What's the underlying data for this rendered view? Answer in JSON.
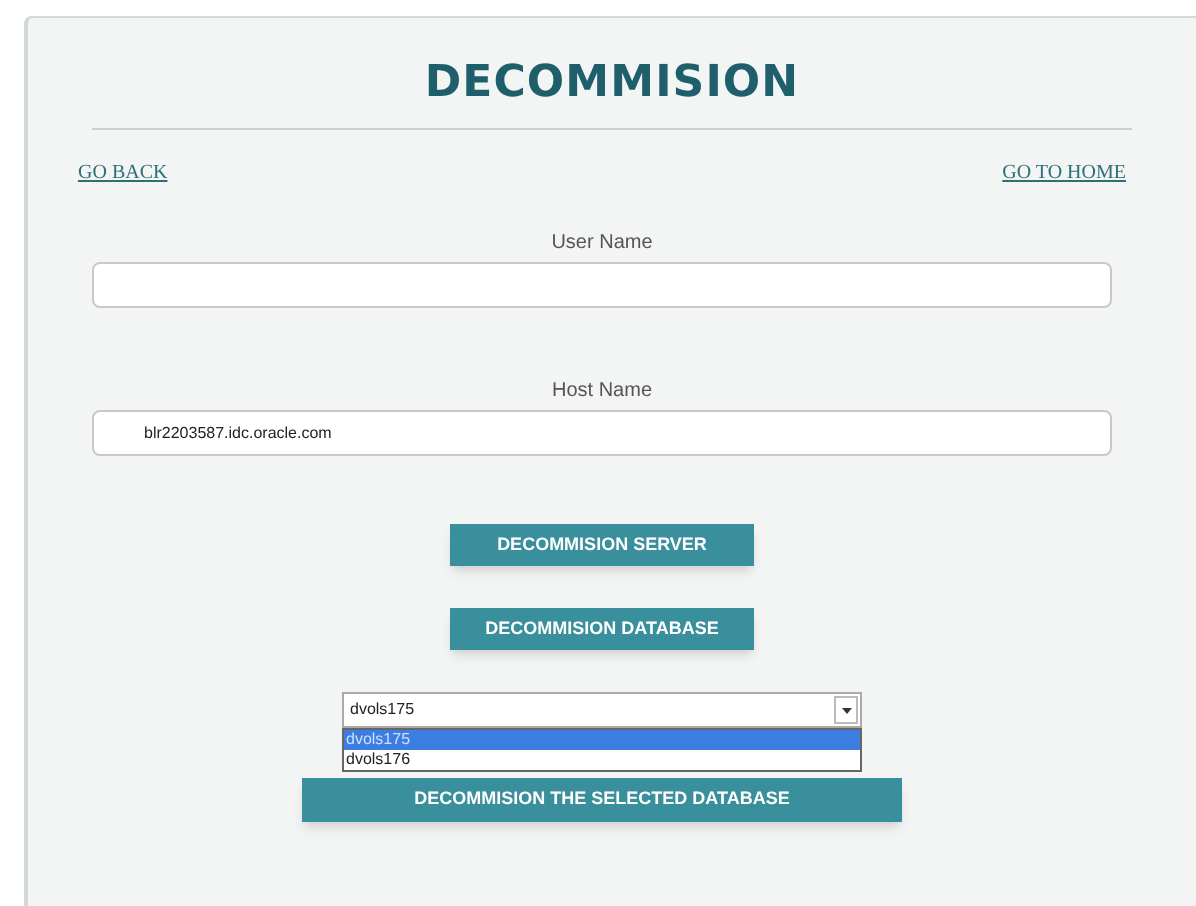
{
  "title": "DECOMMISION",
  "nav": {
    "back": "GO BACK",
    "home": "GO TO HOME"
  },
  "fields": [
    {
      "label": "User Name"
    },
    {
      "label": "Host Name",
      "value": "blr2203587.idc.oracle.com"
    }
  ],
  "buttons": [
    "DECOMMISION SERVER",
    "DECOMMISION DATABASE"
  ],
  "database_select": {
    "value": "dvols175",
    "expanded": true,
    "options": [
      {
        "label": "dvols175",
        "selected": true
      },
      {
        "label": "dvols176",
        "selected": false
      }
    ]
  },
  "submit": "DECOMMISION THE SELECTED DATABASE"
}
